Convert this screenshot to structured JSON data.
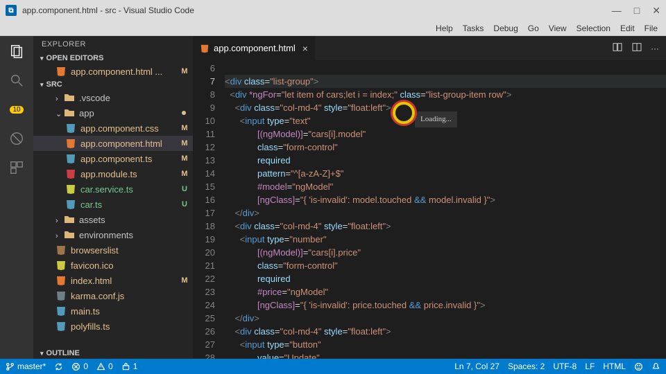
{
  "window": {
    "title": "app.component.html - src - Visual Studio Code"
  },
  "menu": [
    "Help",
    "Tasks",
    "Debug",
    "Go",
    "View",
    "Selection",
    "Edit",
    "File"
  ],
  "activity": {
    "badge": "10"
  },
  "explorer": {
    "title": "EXPLORER",
    "sections": {
      "open_editors": "OPEN EDITORS",
      "src": "SRC",
      "outline": "OUTLINE"
    },
    "open_editor_file": "app.component.html  ...",
    "tree": [
      {
        "name": ".vscode",
        "type": "folder",
        "indent": 2,
        "open": false
      },
      {
        "name": "app",
        "type": "folder",
        "indent": 2,
        "open": true,
        "dot": true
      },
      {
        "name": "app.component.css",
        "type": "file",
        "indent": 3,
        "status": "M",
        "icon": "blue"
      },
      {
        "name": "app.component.html",
        "type": "file",
        "indent": 3,
        "status": "M",
        "icon": "orange",
        "sel": true
      },
      {
        "name": "app.component.ts",
        "type": "file",
        "indent": 3,
        "status": "M",
        "icon": "blue"
      },
      {
        "name": "app.module.ts",
        "type": "file",
        "indent": 3,
        "status": "M",
        "icon": "red"
      },
      {
        "name": "car.service.ts",
        "type": "file",
        "indent": 3,
        "status": "U",
        "icon": "yellow"
      },
      {
        "name": "car.ts",
        "type": "file",
        "indent": 3,
        "status": "U",
        "icon": "blue"
      },
      {
        "name": "assets",
        "type": "folder",
        "indent": 2,
        "open": false
      },
      {
        "name": "environments",
        "type": "folder",
        "indent": 2,
        "open": false
      },
      {
        "name": "browserslist",
        "type": "file",
        "indent": 2,
        "icon": "brown"
      },
      {
        "name": "favicon.ico",
        "type": "file",
        "indent": 2,
        "icon": "yellow"
      },
      {
        "name": "index.html",
        "type": "file",
        "indent": 2,
        "status": "M",
        "icon": "orange"
      },
      {
        "name": "karma.conf.js",
        "type": "file",
        "indent": 2,
        "icon": "gray"
      },
      {
        "name": "main.ts",
        "type": "file",
        "indent": 2,
        "icon": "blue"
      },
      {
        "name": "polyfills.ts",
        "type": "file",
        "indent": 2,
        "icon": "blue"
      }
    ]
  },
  "tab": {
    "label": "app.component.html"
  },
  "gutter_start": 6,
  "gutter_end": 28,
  "gutter_current": 7,
  "tooltip": "Loading...",
  "status": {
    "branch": "master*",
    "errors": "0",
    "warnings": "0",
    "launch": "1",
    "ln_col": "Ln 7, Col 27",
    "spaces": "Spaces: 2",
    "encoding": "UTF-8",
    "eol": "LF",
    "lang": "HTML"
  }
}
